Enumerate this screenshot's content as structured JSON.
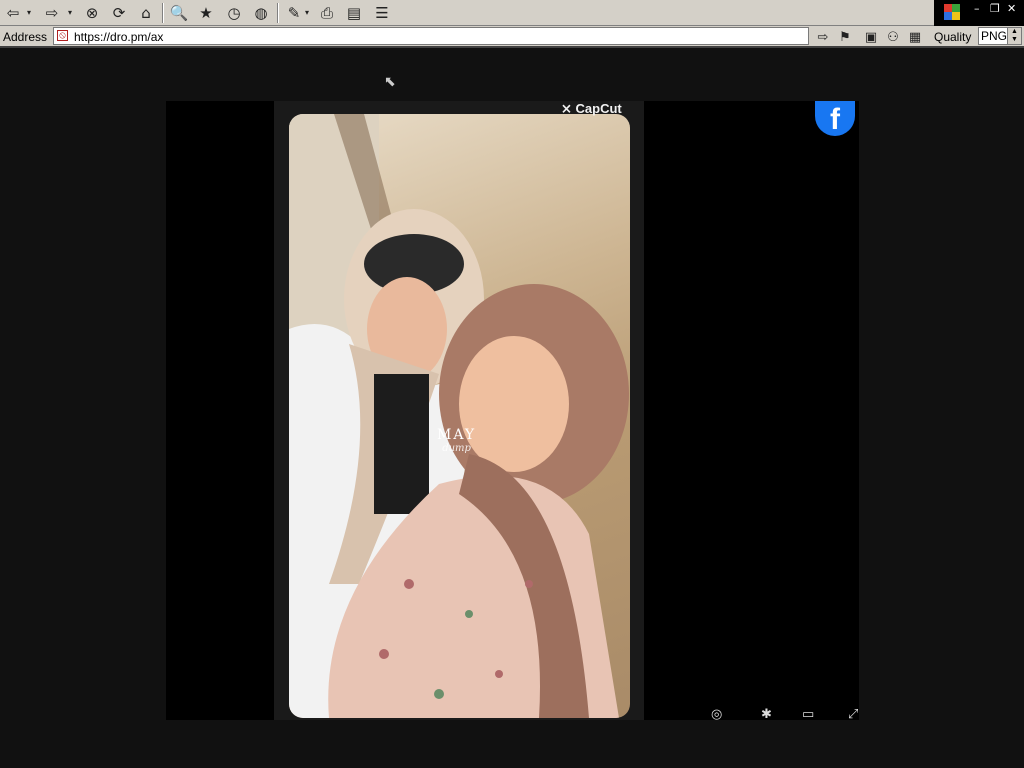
{
  "toolbar": {
    "buttons": [
      {
        "name": "back-button",
        "glyph": "⇦"
      },
      {
        "name": "forward-button",
        "glyph": "⇨"
      },
      {
        "name": "stop-button",
        "glyph": "⊗"
      },
      {
        "name": "refresh-button",
        "glyph": "⟳"
      },
      {
        "name": "home-button",
        "glyph": "⌂"
      },
      {
        "name": "search-button",
        "glyph": "🔍"
      },
      {
        "name": "favorites-button",
        "glyph": "★"
      },
      {
        "name": "history-button",
        "glyph": "◷"
      },
      {
        "name": "channels-button",
        "glyph": "◍"
      },
      {
        "name": "edit-button",
        "glyph": "✎"
      },
      {
        "name": "print-button",
        "glyph": "⎙"
      },
      {
        "name": "discuss-button",
        "glyph": "▤"
      },
      {
        "name": "messenger-button",
        "glyph": "☰"
      }
    ],
    "drop_glyph": "▾",
    "window_controls": {
      "minimize": "–",
      "restore": "❐",
      "close": "✕"
    }
  },
  "address_bar": {
    "label": "Address",
    "url": "https://dro.pm/ax",
    "go_glyph": "⇨",
    "bookmark_glyph": "⚑",
    "icons": [
      "▣",
      "⚇",
      "▦"
    ],
    "quality_label": "Quality",
    "format_value": "PNG",
    "format_spin": "▲\n▼"
  },
  "content": {
    "cursor_glyph": "⬉",
    "capcut_label": "⨯ CapCut",
    "photo_main_text": "MAY",
    "photo_sub_text": "dump",
    "facebook_glyph": "f",
    "player_controls": [
      "◎",
      "✱",
      "▭",
      "⤢"
    ]
  },
  "colors": {
    "page_background": "#111111",
    "chrome_background": "#d4d0c8",
    "facebook_blue": "#1877f2"
  }
}
